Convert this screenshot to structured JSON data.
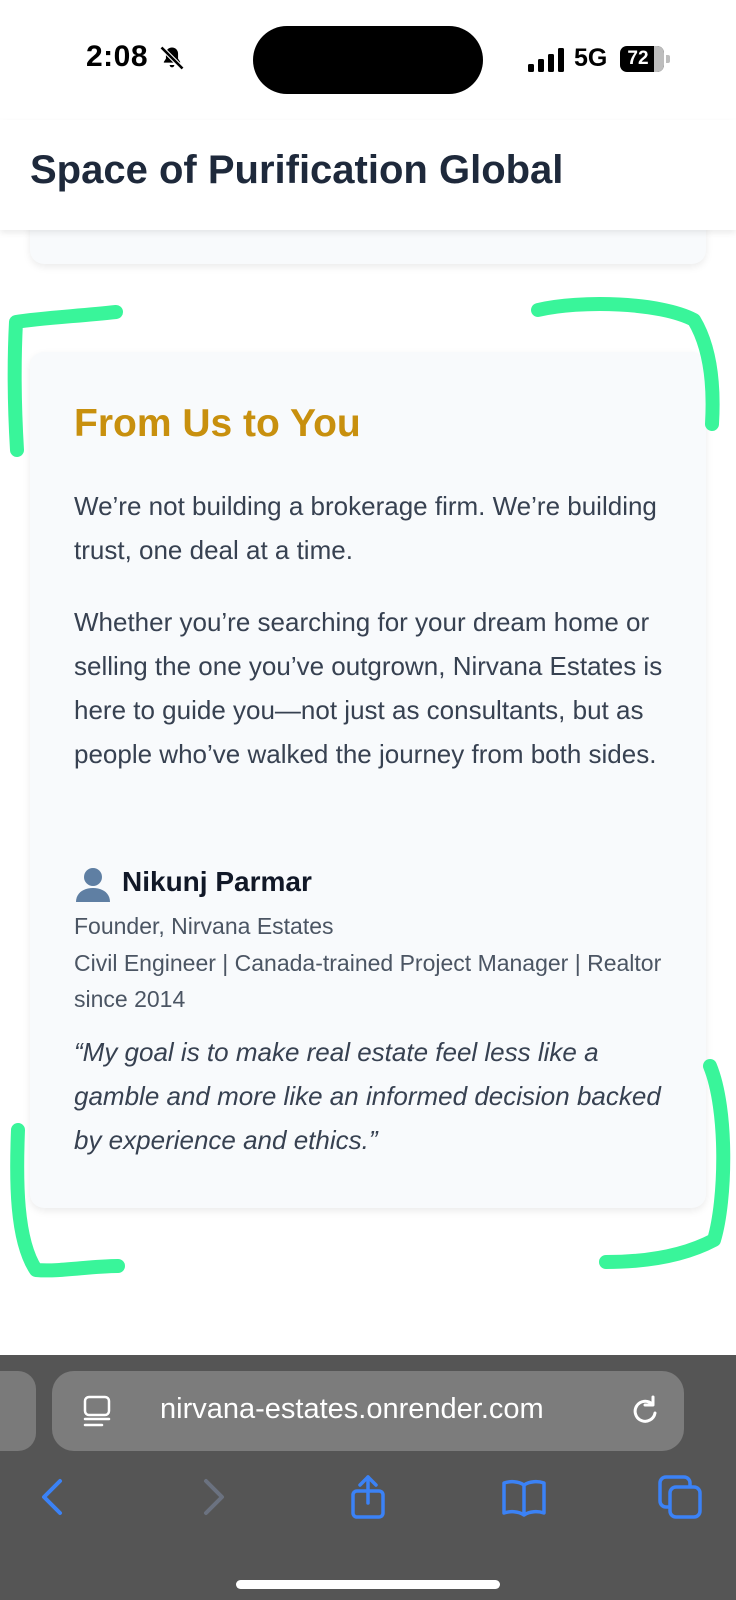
{
  "status_bar": {
    "time": "2:08",
    "network": "5G",
    "battery_percent": "72",
    "icons": [
      "bell-slash-icon",
      "signal-icon",
      "battery-icon"
    ]
  },
  "site": {
    "title": "Space of Purification Global"
  },
  "card": {
    "title": "From Us to You",
    "paragraphs": [
      "We’re not building a brokerage firm. We’re building trust, one deal at a time.",
      "Whether you’re searching for your dream home or selling the one you’ve outgrown, Nirvana Estates is here to guide you—not just as consultants, but as people who’ve walked the journey from both sides."
    ],
    "founder_icon": "👤",
    "founder_name": "Nikunj Parmar",
    "founder_role": "Founder, Nirvana Estates",
    "founder_credentials": "Civil Engineer | Canada-trained Project Manager | Realtor since 2014",
    "quote": "“My goal is to make real estate feel less like a gamble and more like an informed decision backed by experience and ethics.”"
  },
  "browser": {
    "url": "nirvana-estates.onrender.com",
    "icons": [
      "reader-icon",
      "reload-icon",
      "back-icon",
      "forward-icon",
      "share-icon",
      "bookmarks-icon",
      "tabs-icon"
    ]
  },
  "colors": {
    "accent_title": "#c8900e",
    "annotation": "#39f59a",
    "browser_chrome": "#555555",
    "ios_blue": "#3b82f6"
  }
}
